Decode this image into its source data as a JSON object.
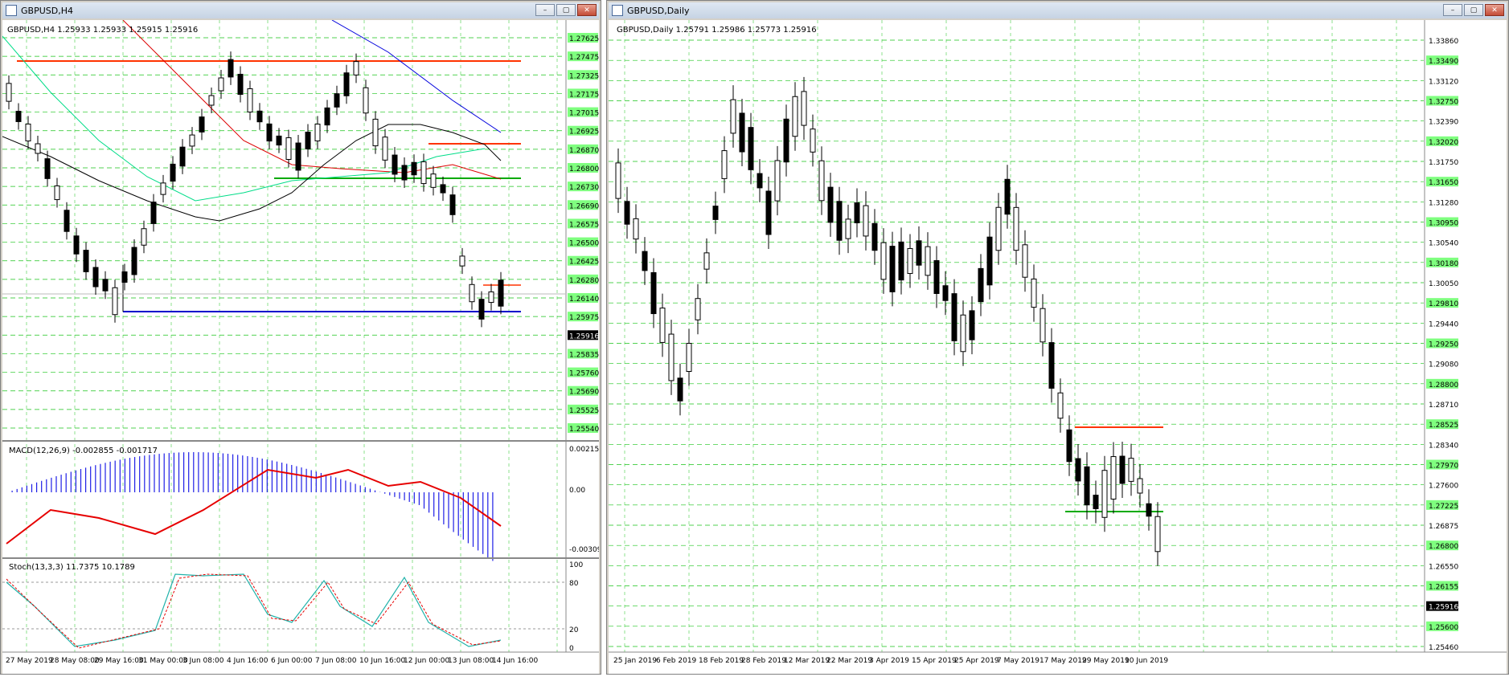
{
  "left_window": {
    "title": "GBPUSD,H4",
    "header": "GBPUSD,H4  1.25933 1.25933 1.25915 1.25916",
    "price_labels": [
      "1.27625",
      "1.27475",
      "1.27325",
      "1.27175",
      "1.27015",
      "1.26925",
      "1.26870",
      "1.26800",
      "1.26730",
      "1.26690",
      "1.26575",
      "1.26500",
      "1.26425",
      "1.26280",
      "1.26140",
      "1.25975",
      "1.25916",
      "1.25835",
      "1.25760",
      "1.25690",
      "1.25525",
      "1.25540"
    ],
    "current_price": "1.25916",
    "macd_label": "MACD(12,26,9) -0.002855 -0.001717",
    "macd_scale": [
      "0.002152",
      "0.00",
      "-0.003093"
    ],
    "stoch_label": "Stoch(13,3,3) 11.7375 10.1789",
    "stoch_scale": [
      "100",
      "80",
      "20",
      "0"
    ],
    "time_labels": [
      "27 May 2019",
      "28 May 08:00",
      "29 May 16:00",
      "31 May 00:00",
      "3 Jun 08:00",
      "4 Jun 16:00",
      "6 Jun 00:00",
      "7 Jun 08:00",
      "10 Jun 16:00",
      "12 Jun 00:00",
      "13 Jun 08:00",
      "14 Jun 16:00"
    ]
  },
  "right_window": {
    "title": "GBPUSD,Daily",
    "header": "GBPUSD,Daily  1.25791 1.25986 1.25773 1.25916",
    "price_labels": [
      "1.33860",
      "1.33490",
      "1.33120",
      "1.32750",
      "1.32390",
      "1.32020",
      "1.31750",
      "1.31650",
      "1.31280",
      "1.30950",
      "1.30540",
      "1.30180",
      "1.30050",
      "1.29810",
      "1.29440",
      "1.29250",
      "1.29080",
      "1.28800",
      "1.28710",
      "1.28525",
      "1.28340",
      "1.27970",
      "1.27600",
      "1.27225",
      "1.26875",
      "1.26800",
      "1.26550",
      "1.26155",
      "1.25916",
      "1.25600",
      "1.25460"
    ],
    "current_price": "1.25916",
    "time_labels": [
      "25 Jan 2019",
      "6 Feb 2019",
      "18 Feb 2019",
      "28 Feb 2019",
      "12 Mar 2019",
      "22 Mar 2019",
      "3 Apr 2019",
      "15 Apr 2019",
      "25 Apr 2019",
      "7 May 2019",
      "17 May 2019",
      "29 May 2019",
      "10 Jun 2019"
    ]
  },
  "window_buttons": {
    "minimize": "–",
    "maximize": "▢",
    "close": "✕"
  },
  "colors": {
    "grid": "#19c319",
    "label_bg": "#7fff7f",
    "red_line": "#ff3300",
    "green_line": "#00aa00",
    "blue_line": "#0000cc",
    "macd_hist": "#1e1ee6",
    "macd_signal": "#e60000",
    "stoch_main": "#20b2aa",
    "stoch_signal": "#e60000"
  }
}
